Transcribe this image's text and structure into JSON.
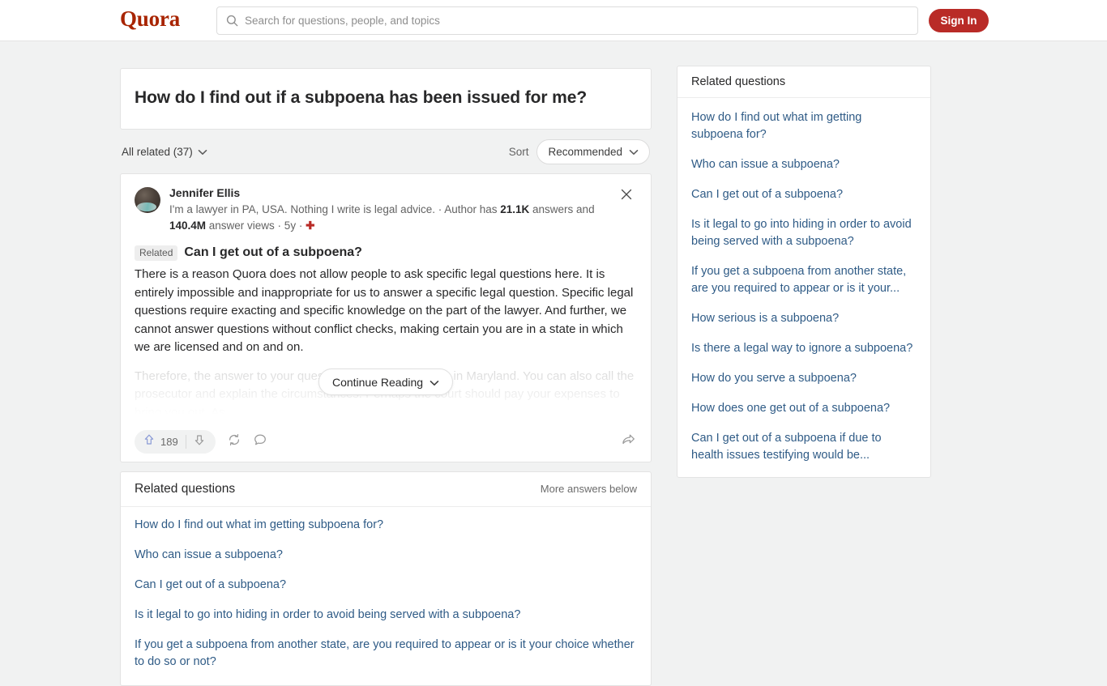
{
  "header": {
    "logo": "Quora",
    "search_placeholder": "Search for questions, people, and topics",
    "search_value": "",
    "signin_label": "Sign In",
    "search_icon": "search-icon"
  },
  "question": {
    "title": "How do I find out if a subpoena has been issued for me?",
    "all_related_label": "All related (37)",
    "sort_label": "Sort",
    "sort_value": "Recommended"
  },
  "answer": {
    "author_name": "Jennifer Ellis",
    "bio_part1": "I'm a lawyer in PA, USA. Nothing I write is legal advice. · Author has ",
    "bio_answers_count": "21.1K",
    "bio_part2": " answers and ",
    "bio_views_count": "140.4M",
    "bio_part3": " answer views · 5y · ",
    "follow_icon": "plus-icon",
    "close_icon": "close-icon",
    "related_badge": "Related",
    "related_question": "Can I get out of a subpoena?",
    "body": "There is a reason Quora does not allow people to ask specific legal questions here. It is entirely impossible and inappropriate for us to answer a specific legal question. Specific legal questions require exacting and specific knowledge on the part of the lawyer. And further, we cannot answer questions without conflict checks, making certain you are in a state in which we are licensed and on and on.",
    "body_faded": "Therefore, the answer to your question is, contact a lawyer in Maryland. You can also call the prosecutor and explain the circumstances. Perhaps the court should pay your expenses to bring you out. As",
    "continue_label": "Continue Reading",
    "upvote_count": "189",
    "icons": {
      "upvote": "upvote-arrow-icon",
      "downvote": "downvote-arrow-icon",
      "repost": "repost-icon",
      "comment": "comment-bubble-icon",
      "share": "share-arrow-icon"
    }
  },
  "related_main": {
    "heading": "Related questions",
    "more_label": "More answers below",
    "items": [
      "How do I find out what im getting subpoena for?",
      "Who can issue a subpoena?",
      "Can I get out of a subpoena?",
      "Is it legal to go into hiding in order to avoid being served with a subpoena?",
      "If you get a subpoena from another state, are you required to appear or is it your choice whether to do so or not?"
    ]
  },
  "sidebar": {
    "heading": "Related questions",
    "items": [
      "How do I find out what im getting subpoena for?",
      "Who can issue a subpoena?",
      "Can I get out of a subpoena?",
      "Is it legal to go into hiding in order to avoid being served with a subpoena?",
      "If you get a subpoena from another state, are you required to appear or is it your...",
      "How serious is a subpoena?",
      "Is there a legal way to ignore a subpoena?",
      "How do you serve a subpoena?",
      "How does one get out of a subpoena?",
      "Can I get out of a subpoena if due to health issues testifying would be..."
    ]
  },
  "colors": {
    "brand_red": "#a82400",
    "signin_red": "#b92b27",
    "link_blue": "#2f5b86",
    "upvote_blue": "#8a9ad6",
    "page_bg": "#f1f2f2"
  }
}
